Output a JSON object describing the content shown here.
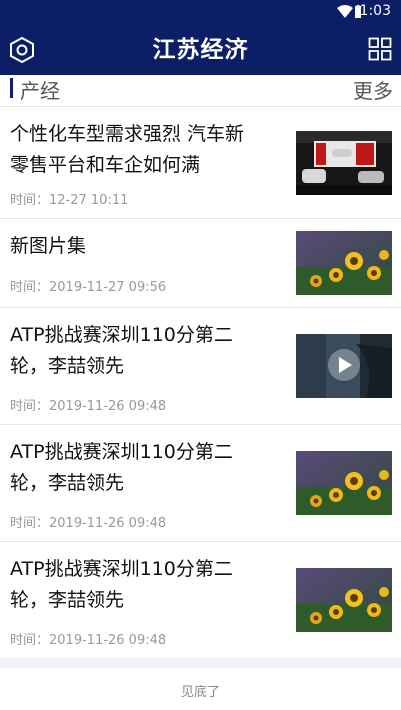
{
  "status": {
    "time": "1:03"
  },
  "header": {
    "title": "江苏经济"
  },
  "section": {
    "title": "产经",
    "more": "更多"
  },
  "articles": [
    {
      "title": "个性化车型需求强烈 汽车新零售平台和车企如何满",
      "time": "时间：12-27 10:11",
      "thumb": "car-show-image"
    },
    {
      "title": "新图片集",
      "time": "时间：2019-11-27 09:56",
      "thumb": "sunflower-image"
    },
    {
      "title": "ATP挑战赛深圳110分第二轮，李喆领先",
      "time": "时间：2019-11-26 09:48",
      "thumb": "video-thumbnail"
    },
    {
      "title": "ATP挑战赛深圳110分第二轮，李喆领先",
      "time": "时间：2019-11-26 09:48",
      "thumb": "sunflower-image"
    },
    {
      "title": "ATP挑战赛深圳110分第二轮，李喆领先",
      "time": "时间：2019-11-26 09:48",
      "thumb": "sunflower-image"
    }
  ],
  "footer": {
    "text": "见底了"
  },
  "colors": {
    "brand": "#0c1f66",
    "divider": "#e6e6e6",
    "muted": "#999999"
  }
}
